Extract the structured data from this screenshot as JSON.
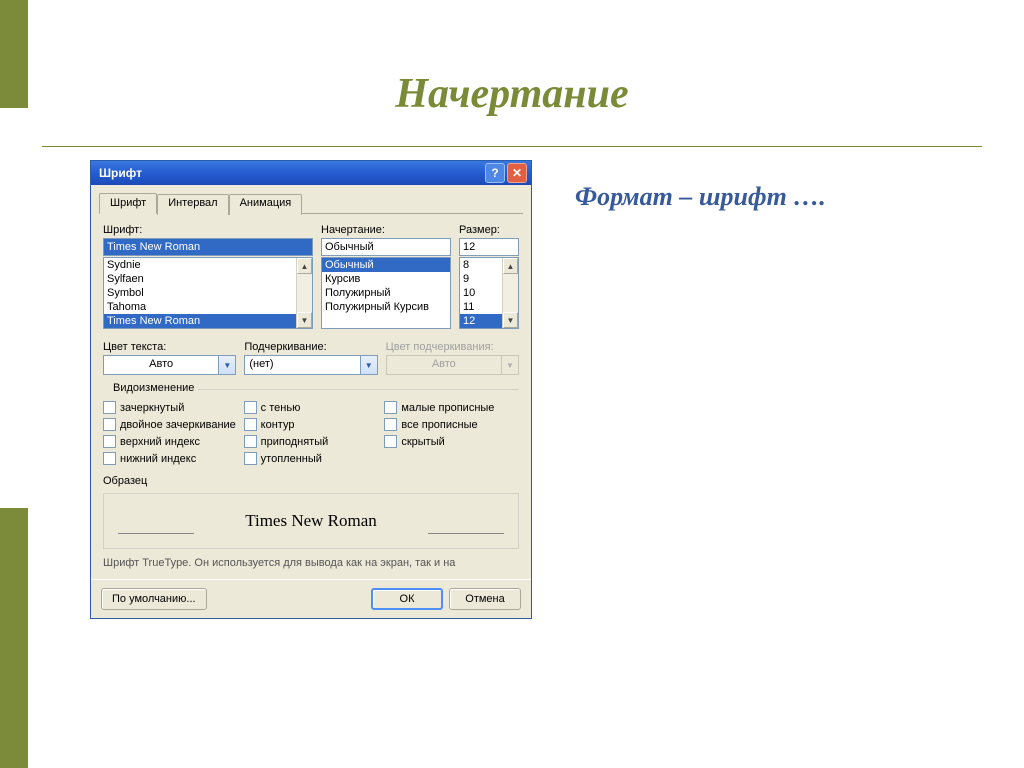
{
  "slide": {
    "title": "Начертание",
    "caption": "Формат – шрифт …."
  },
  "dialog": {
    "title": "Шрифт",
    "tabs": {
      "font": "Шрифт",
      "interval": "Интервал",
      "animation": "Анимация"
    },
    "labels": {
      "font": "Шрифт:",
      "style": "Начертание:",
      "size": "Размер:",
      "textColor": "Цвет текста:",
      "underline": "Подчеркивание:",
      "underlineColor": "Цвет подчеркивания:",
      "effects": "Видоизменение",
      "sample": "Образец"
    },
    "font": {
      "value": "Times New Roman",
      "options": [
        "Sydnie",
        "Sylfaen",
        "Symbol",
        "Tahoma",
        "Times New Roman"
      ]
    },
    "style": {
      "value": "Обычный",
      "options": [
        "Обычный",
        "Курсив",
        "Полужирный",
        "Полужирный Курсив"
      ]
    },
    "size": {
      "value": "12",
      "options": [
        "8",
        "9",
        "10",
        "11",
        "12"
      ]
    },
    "textColor": "Авто",
    "underline": "(нет)",
    "underlineColor": "Авто",
    "effects": {
      "col1": [
        "зачеркнутый",
        "двойное зачеркивание",
        "верхний индекс",
        "нижний индекс"
      ],
      "col2": [
        "с тенью",
        "контур",
        "приподнятый",
        "утопленный"
      ],
      "col3": [
        "малые прописные",
        "все прописные",
        "скрытый"
      ]
    },
    "sampleText": "Times New Roman",
    "hint": "Шрифт TrueType. Он используется для вывода как на экран, так и на",
    "buttons": {
      "default": "По умолчанию...",
      "ok": "ОК",
      "cancel": "Отмена"
    }
  }
}
